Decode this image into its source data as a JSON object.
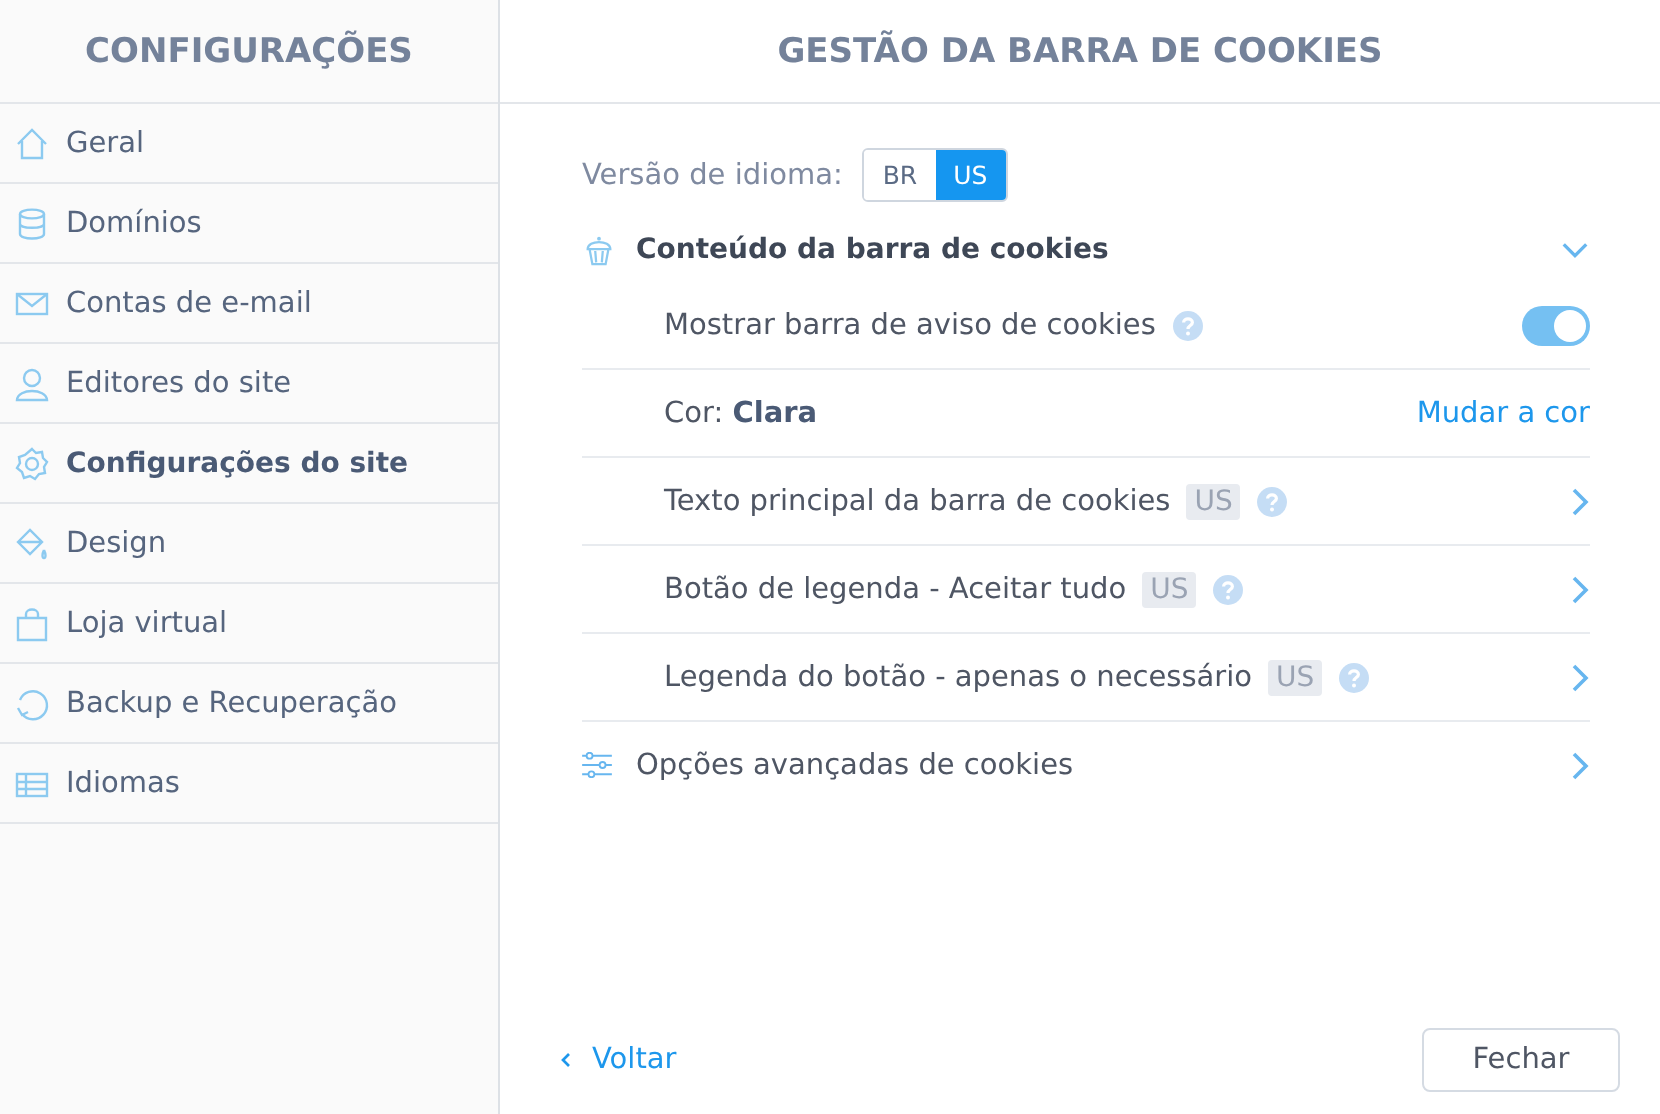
{
  "sidebar": {
    "title": "CONFIGURAÇÕES",
    "items": [
      {
        "label": "Geral",
        "selected": false
      },
      {
        "label": "Domínios",
        "selected": false
      },
      {
        "label": "Contas de e-mail",
        "selected": false
      },
      {
        "label": "Editores do site",
        "selected": false
      },
      {
        "label": "Configurações do site",
        "selected": true
      },
      {
        "label": "Design",
        "selected": false
      },
      {
        "label": "Loja virtual",
        "selected": false
      },
      {
        "label": "Backup e Recuperação",
        "selected": false
      },
      {
        "label": "Idiomas",
        "selected": false
      }
    ]
  },
  "main": {
    "title": "GESTÃO DA BARRA DE COOKIES",
    "language": {
      "label": "Versão de idioma:",
      "options": [
        {
          "label": "BR",
          "selected": false
        },
        {
          "label": "US",
          "selected": true
        }
      ]
    },
    "section": {
      "title": "Conteúdo da barra de cookies",
      "expanded": true,
      "rows": [
        {
          "kind": "toggle",
          "label": "Mostrar barra de aviso de cookies",
          "on": true
        },
        {
          "kind": "color",
          "label": "Cor:",
          "value": "Clara",
          "action": "Mudar a cor"
        },
        {
          "kind": "link",
          "label": "Texto principal da barra de cookies",
          "badge": "US"
        },
        {
          "kind": "link",
          "label": "Botão de legenda - Aceitar tudo",
          "badge": "US"
        },
        {
          "kind": "link",
          "label": "Legenda do botão - apenas o necessário",
          "badge": "US"
        }
      ]
    },
    "advanced": {
      "label": "Opções avançadas de cookies"
    },
    "footer": {
      "back": "Voltar",
      "close": "Fechar"
    }
  }
}
